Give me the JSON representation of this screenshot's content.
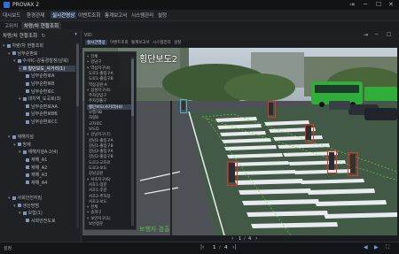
{
  "app": {
    "title": "PROVAX 2"
  },
  "window_controls": [
    "⇥",
    "─",
    "☐",
    "✕"
  ],
  "menu": [
    "대시보드",
    "환경관제",
    "실시간영상",
    "이벤트조회",
    "통계보고서",
    "시스템관리",
    "설정"
  ],
  "menu_active_index": 2,
  "left": {
    "tabs": [
      "고위치",
      "차량/차 현황조회"
    ],
    "active_tab": 1,
    "header": "차량/차 현황조회",
    "tree": [
      {
        "level": 0,
        "label": "차량/차 현황조회",
        "twist": "▾"
      },
      {
        "level": 1,
        "label": "남부순환로",
        "twist": "▾"
      },
      {
        "level": 2,
        "label": "수서IC-강동경찰청(남북)",
        "twist": "▾"
      },
      {
        "level": 3,
        "label": "횡단보도_사거리(1)",
        "twist": "▾",
        "selected": true
      },
      {
        "level": 4,
        "label": "남부순환로A",
        "twist": ""
      },
      {
        "level": 4,
        "label": "남부순환로B",
        "twist": ""
      },
      {
        "level": 4,
        "label": "남부순환로C",
        "twist": ""
      },
      {
        "level": 3,
        "label": "대치역_도곡로(3)",
        "twist": "▾"
      },
      {
        "level": 4,
        "label": "남부순환로AA",
        "twist": ""
      },
      {
        "level": 4,
        "label": "남부순환로BB",
        "twist": ""
      },
      {
        "level": 4,
        "label": "남부순환로CC",
        "twist": ""
      },
      {
        "level": 0,
        "label": "",
        "twist": ""
      },
      {
        "level": 1,
        "label": "재해지설",
        "twist": "▾"
      },
      {
        "level": 2,
        "label": "방재",
        "twist": "▾"
      },
      {
        "level": 3,
        "label": "재해지설A-2(4)",
        "twist": "▾"
      },
      {
        "level": 4,
        "label": "재해_A1",
        "twist": ""
      },
      {
        "level": 4,
        "label": "재해_A2",
        "twist": ""
      },
      {
        "level": 4,
        "label": "재해_A3",
        "twist": ""
      },
      {
        "level": 4,
        "label": "재해_A4",
        "twist": ""
      },
      {
        "level": 0,
        "label": "",
        "twist": ""
      },
      {
        "level": 1,
        "label": "사회안전지킴",
        "twist": "▾"
      },
      {
        "level": 2,
        "label": "생산방범",
        "twist": "▾"
      },
      {
        "level": 3,
        "label": "보험(1)",
        "twist": "▾"
      },
      {
        "level": 4,
        "label": "사회안전도로",
        "twist": ""
      }
    ]
  },
  "video": {
    "head_label": "VID",
    "tabs": [
      "실시간영상",
      "이벤트조회",
      "통계보고서",
      "시스템관리",
      "설정"
    ],
    "overlay_title": "횡단보도2",
    "overlay_title_suffix": "",
    "bottom_watermark": "보행자 검출",
    "overlay_tree": [
      {
        "label": "전체",
        "twist": "▾"
      },
      {
        "label": "강남구",
        "twist": "▾"
      },
      {
        "label": "역삼지구(4)",
        "twist": "▾"
      },
      {
        "label": "도로1-출입구A",
        "twist": ""
      },
      {
        "label": "도로1-출입구B",
        "twist": ""
      },
      {
        "label": "역삼공원-A",
        "twist": ""
      },
      {
        "label": "삼성지구(4)",
        "twist": "▾"
      },
      {
        "label": "주차장입구",
        "twist": ""
      },
      {
        "label": "주차장출구",
        "twist": ""
      },
      {
        "label": "횡단보도(사거리)(4)",
        "twist": "",
        "selected": true
      },
      {
        "label": "보행자B",
        "twist": ""
      },
      {
        "label": "차량B",
        "twist": ""
      },
      {
        "label": "교차로C",
        "twist": ""
      },
      {
        "label": "보도D",
        "twist": ""
      },
      {
        "label": "강남지구(7)",
        "twist": "▾"
      },
      {
        "label": "강남1-출입구A",
        "twist": ""
      },
      {
        "label": "강남1-출입구B",
        "twist": ""
      },
      {
        "label": "강남2-출입구A",
        "twist": ""
      },
      {
        "label": "강남2-출입구B",
        "twist": ""
      },
      {
        "label": "도로3-교차로",
        "twist": ""
      },
      {
        "label": "도로3-보도",
        "twist": ""
      },
      {
        "label": "강남공원",
        "twist": ""
      },
      {
        "label": "서초지구(6)",
        "twist": "▾"
      },
      {
        "label": "서초1-정문",
        "twist": ""
      },
      {
        "label": "서초1-후문",
        "twist": ""
      },
      {
        "label": "서초2-주차장",
        "twist": ""
      },
      {
        "label": "서초3-보도",
        "twist": ""
      },
      {
        "label": "전체",
        "twist": "▾"
      },
      {
        "label": "송파구",
        "twist": "▾"
      },
      {
        "label": "보안지구(1)",
        "twist": "▾"
      },
      {
        "label": "보안정문",
        "twist": ""
      }
    ],
    "pager": {
      "prev": "‹",
      "page": "1",
      "sep": "/",
      "total": "4",
      "next": "›"
    }
  },
  "bottom": {
    "left_label": "설정",
    "pager": {
      "first": "|‹",
      "page": "1",
      "sep": "/",
      "total": "4",
      "last": "›|"
    },
    "right_icons": [
      "◀",
      "▶",
      "⛶"
    ]
  },
  "colors": {
    "accent": "#2f6fd6",
    "detect_box": "#e0322a",
    "bus": "#2fae3a"
  }
}
